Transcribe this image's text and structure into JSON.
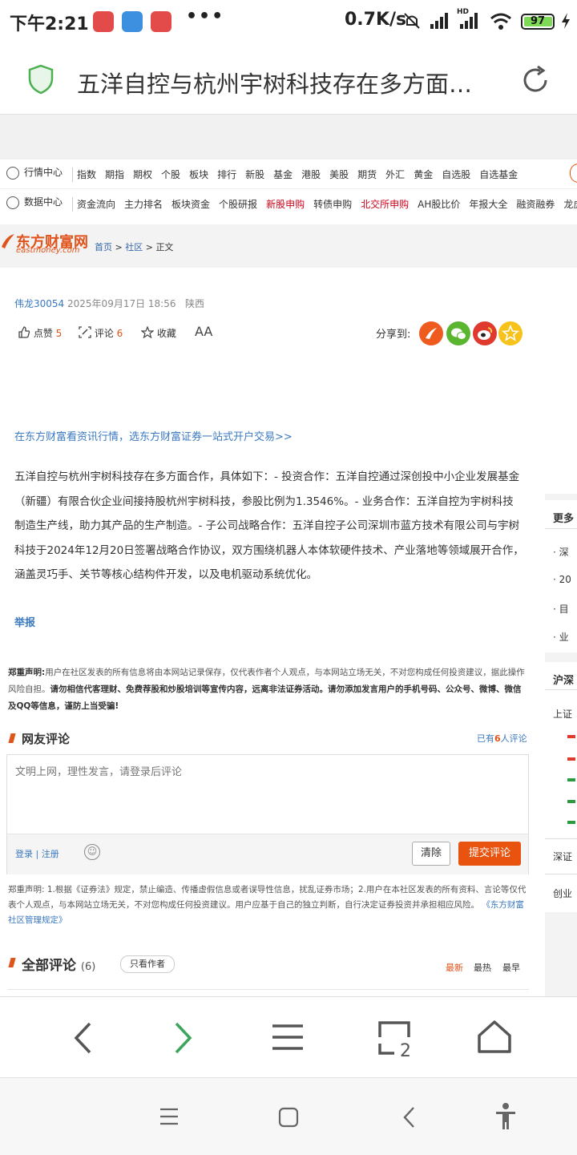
{
  "status_bar": {
    "time": "下午2:21",
    "more": "•••",
    "speed": "0.7K/s",
    "network": "HD",
    "battery": "97"
  },
  "address_bar": {
    "title": "五洋自控与杭州宇树科技存在多方面…"
  },
  "nav_market": {
    "label": "行情中心",
    "items": [
      "指数",
      "期指",
      "期权",
      "个股",
      "板块",
      "排行",
      "新股",
      "基金",
      "港股",
      "美股",
      "期货",
      "外汇",
      "黄金",
      "自选股",
      "自选基金"
    ]
  },
  "nav_data": {
    "label": "数据中心",
    "items": [
      "资金流向",
      "主力排名",
      "板块资金",
      "个股研报",
      "新股申购",
      "转债申购",
      "北交所申购",
      "AH股比价",
      "年报大全",
      "融资融券",
      "龙虎榜"
    ]
  },
  "logo": {
    "main": "东方财富网",
    "sub": "eastmoney.com"
  },
  "breadcrumb": {
    "home": "首页",
    "sep1": " > ",
    "community": "社区",
    "sep2": " > ",
    "current": "正文"
  },
  "article": {
    "author": "伟龙30054",
    "datetime": "2025年09月17日 18:56",
    "location": "陕西",
    "like_label": "点赞",
    "like_count": "5",
    "comment_label": "评论",
    "comment_count": "6",
    "fav_label": "收藏",
    "font_label": "AA",
    "share_label": "分享到:",
    "promo": "在东方财富看资讯行情，选东方财富证券一站式开户交易>>",
    "body": "五洋自控与杭州宇树科技存在多方面合作，具体如下：- 投资合作：五洋自控通过深创投中小企业发展基金（新疆）有限合伙企业间接持股杭州宇树科技，参股比例为1.3546%。- 业务合作：五洋自控为宇树科技制造生产线，助力其产品的生产制造。- 子公司战略合作：五洋自控子公司深圳市蓝方技术有限公司与宇树科技于2024年12月20日签署战略合作协议，双方围绕机器人本体软硬件技术、产业落地等领域展开合作，涵盖灵巧手、关节等核心结构件开发，以及电机驱动系统优化。",
    "report": "举报"
  },
  "disclaimer": {
    "label": "郑重声明:",
    "text": "用户在社区发表的所有信息将由本网站记录保存，仅代表作者个人观点，与本网站立场无关，不对您构成任何投资建议，据此操作风险自担。",
    "bold": "请勿相信代客理财、免费荐股和炒股培训等宣传内容，远离非法证券活动。请勿添加发言用户的手机号码、公众号、微博、微信及QQ等信息，谨防上当受骗!"
  },
  "comments": {
    "title": "网友评论",
    "count_prefix": "已有",
    "count": "6",
    "count_suffix": "人评论",
    "placeholder": "文明上网，理性发言，请登录后评论",
    "login": "登录",
    "login_sep": " | ",
    "register": "注册",
    "clear": "清除",
    "submit": "提交评论"
  },
  "legal": {
    "text": "郑重声明: 1.根据《证券法》规定，禁止编造、传播虚假信息或者误导性信息，扰乱证券市场；2.用户在本社区发表的所有资料、言论等仅代表个人观点，与本网站立场无关，不对您构成任何投资建议。用户应基于自己的独立判断，自行决定证券投资并承担相应风险。",
    "link": "《东方财富社区管理规定》"
  },
  "all_comments": {
    "title": "全部评论",
    "count": "(6)",
    "only_author": "只看作者",
    "sort_latest": "最新",
    "sort_hot": "最热",
    "sort_earliest": "最早"
  },
  "right_column": {
    "more_title": "更多",
    "items": [
      "深",
      "20",
      "目",
      "业"
    ],
    "sh_sz_title": "沪深",
    "sh_label": "上证",
    "sz_label": "深证",
    "cyb_label": "创业"
  },
  "colors": {
    "accent": "#e8540f",
    "link": "#3a78c0",
    "shield": "#4caf50"
  }
}
